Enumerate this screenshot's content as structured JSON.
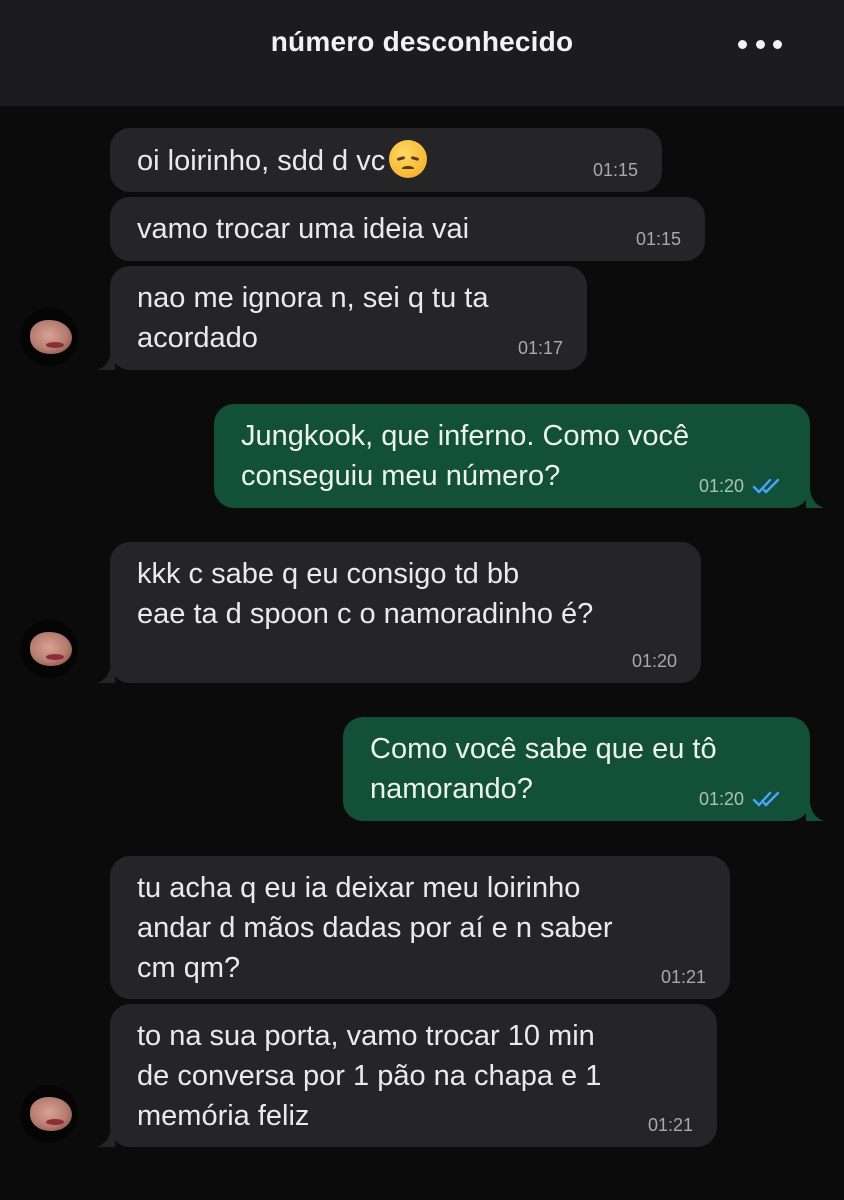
{
  "header": {
    "title": "número desconhecido",
    "menu_icon": "more-dots-icon"
  },
  "messages": [
    {
      "side": "in",
      "text": "oi loirinho, sdd d vc",
      "emoji": "disappointed-face-icon",
      "time": "01:15"
    },
    {
      "side": "in",
      "text": "vamo trocar uma ideia vai",
      "time": "01:15"
    },
    {
      "side": "in",
      "text": "nao me ignora n, sei q tu ta\nacordado",
      "time": "01:17"
    },
    {
      "side": "out",
      "text": "Jungkook, que inferno. Como você\nconseguiu meu número?",
      "time": "01:20",
      "status": "read"
    },
    {
      "side": "in",
      "text": "kkk c sabe q eu consigo td bb\neae ta d spoon c o namoradinho é?",
      "time": "01:20"
    },
    {
      "side": "out",
      "text": "Como você sabe que eu tô\nnamorando?",
      "time": "01:20",
      "status": "read"
    },
    {
      "side": "in",
      "text": "tu acha q eu ia deixar meu loirinho\nandar d mãos dadas por aí e n saber\ncm qm?",
      "time": "01:21"
    },
    {
      "side": "in",
      "text": "to na sua porta, vamo trocar 10 min\nde conversa por 1 pão na chapa e 1\nmemória feliz",
      "time": "01:21"
    }
  ],
  "colors": {
    "incoming": "#252527",
    "outgoing": "#13503a",
    "read_ticks": "#4aa3ff",
    "background": "#0b0b0c"
  }
}
